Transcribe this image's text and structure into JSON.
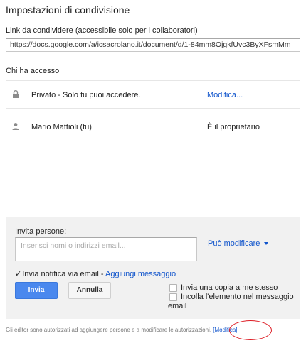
{
  "dialog": {
    "title": "Impostazioni di condivisione"
  },
  "link": {
    "label": "Link da condividere (accessibile solo per i collaboratori)",
    "url": "https://docs.google.com/a/icsacrolano.it/document/d/1-84mm8OjgkfUvc3ByXFsmMm"
  },
  "access": {
    "label": "Chi ha accesso",
    "rows": [
      {
        "icon": "lock-icon",
        "name": "Privato - Solo tu puoi accedere.",
        "action": "Modifica..."
      },
      {
        "icon": "person-icon",
        "name": "Mario Mattioli (tu)",
        "role": "È il proprietario"
      }
    ]
  },
  "invite": {
    "label": "Invita persone:",
    "placeholder": "Inserisci nomi o indirizzi email...",
    "permission": "Può modificare",
    "notify_check": "✓",
    "notify_label": "Invia notifica via email - ",
    "add_message": "Aggiungi messaggio",
    "send_button": "Invia",
    "cancel_button": "Annulla",
    "copy_to_me": "Invia una copia a me stesso",
    "paste_item_line1": "Incolla l'elemento nel messaggio",
    "paste_item_line2": "email"
  },
  "footer": {
    "text": "Gli editor sono autorizzati ad aggiungere persone e a modificare le autorizzazioni.",
    "modify_link": "[Modifica]"
  },
  "colors": {
    "link": "#1155cc",
    "primary_button": "#4a88ee",
    "annotation_circle": "#dd1a22"
  }
}
